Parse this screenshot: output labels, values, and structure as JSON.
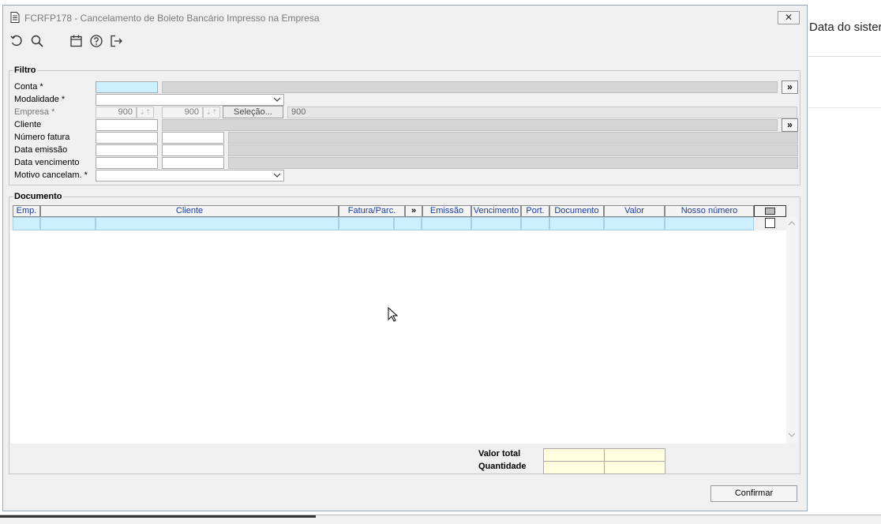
{
  "window": {
    "title": "FCRFP178 - Cancelamento de Boleto Bancário Impresso na Empresa",
    "close_symbol": "✕"
  },
  "background": {
    "partial_text": "Data do sister"
  },
  "toolbar": {
    "icons": [
      "refresh-icon",
      "search-icon",
      "calendar-icon",
      "help-icon",
      "exit-icon"
    ]
  },
  "filter": {
    "title": "Filtro",
    "labels": {
      "conta": "Conta *",
      "modalidade": "Modalidade *",
      "empresa": "Empresa *",
      "cliente": "Cliente",
      "numero_fatura": "Número fatura",
      "data_emissao": "Data emissão",
      "data_vencimento": "Data vencimento",
      "motivo": "Motivo cancelam. *"
    },
    "empresa_from": "900",
    "empresa_to": "900",
    "empresa_desc": "900",
    "selecao_label": "Seleção...",
    "lookup_symbol": "»"
  },
  "documento": {
    "title": "Documento",
    "columns": [
      "Emp.",
      "Cliente",
      "Fatura/Parc.",
      "»",
      "Emissão",
      "Vencimento",
      "Port.",
      "Documento",
      "Valor",
      "Nosso número"
    ]
  },
  "totals": {
    "valor_total": "Valor total",
    "quantidade": "Quantidade"
  },
  "actions": {
    "confirmar": "Confirmar"
  }
}
